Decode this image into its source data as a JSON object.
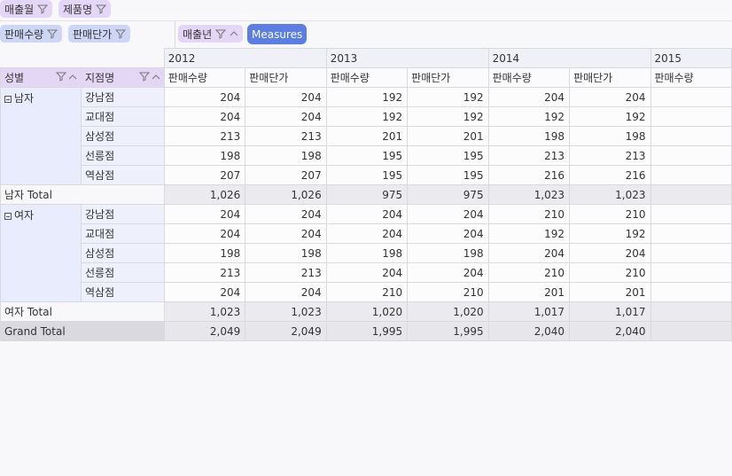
{
  "filter_fields": [
    {
      "label": "매출월"
    },
    {
      "label": "제품명"
    }
  ],
  "data_fields": [
    {
      "label": "판매수량"
    },
    {
      "label": "판매단가"
    }
  ],
  "column_fields": [
    {
      "label": "매출년"
    },
    {
      "label": "Measures"
    }
  ],
  "row_fields": [
    {
      "label": "성별"
    },
    {
      "label": "지점명"
    }
  ],
  "years": [
    "2012",
    "2013",
    "2014",
    "2015"
  ],
  "measures": [
    "판매수량",
    "판매단가"
  ],
  "groups": [
    {
      "label": "남자",
      "rows": [
        {
          "store": "강남점",
          "values": [
            "204",
            "204",
            "192",
            "192",
            "204",
            "204"
          ]
        },
        {
          "store": "교대점",
          "values": [
            "204",
            "204",
            "192",
            "192",
            "192",
            "192"
          ]
        },
        {
          "store": "삼성점",
          "values": [
            "213",
            "213",
            "201",
            "201",
            "198",
            "198"
          ]
        },
        {
          "store": "선릉점",
          "values": [
            "198",
            "198",
            "195",
            "195",
            "213",
            "213"
          ]
        },
        {
          "store": "역삼점",
          "values": [
            "207",
            "207",
            "195",
            "195",
            "216",
            "216"
          ]
        }
      ],
      "total_label": "남자 Total",
      "total_values": [
        "1,026",
        "1,026",
        "975",
        "975",
        "1,023",
        "1,023"
      ]
    },
    {
      "label": "여자",
      "rows": [
        {
          "store": "강남점",
          "values": [
            "204",
            "204",
            "204",
            "204",
            "210",
            "210"
          ]
        },
        {
          "store": "교대점",
          "values": [
            "204",
            "204",
            "204",
            "204",
            "192",
            "192"
          ]
        },
        {
          "store": "삼성점",
          "values": [
            "198",
            "198",
            "198",
            "198",
            "204",
            "204"
          ]
        },
        {
          "store": "선릉점",
          "values": [
            "213",
            "213",
            "204",
            "204",
            "210",
            "210"
          ]
        },
        {
          "store": "역삼점",
          "values": [
            "204",
            "204",
            "210",
            "210",
            "201",
            "201"
          ]
        }
      ],
      "total_label": "여자 Total",
      "total_values": [
        "1,023",
        "1,023",
        "1,020",
        "1,020",
        "1,017",
        "1,017"
      ]
    }
  ],
  "grand_total": {
    "label": "Grand Total",
    "values": [
      "2,049",
      "2,049",
      "1,995",
      "1,995",
      "2,040",
      "2,040"
    ]
  },
  "accent_color": "#5b7ee5"
}
